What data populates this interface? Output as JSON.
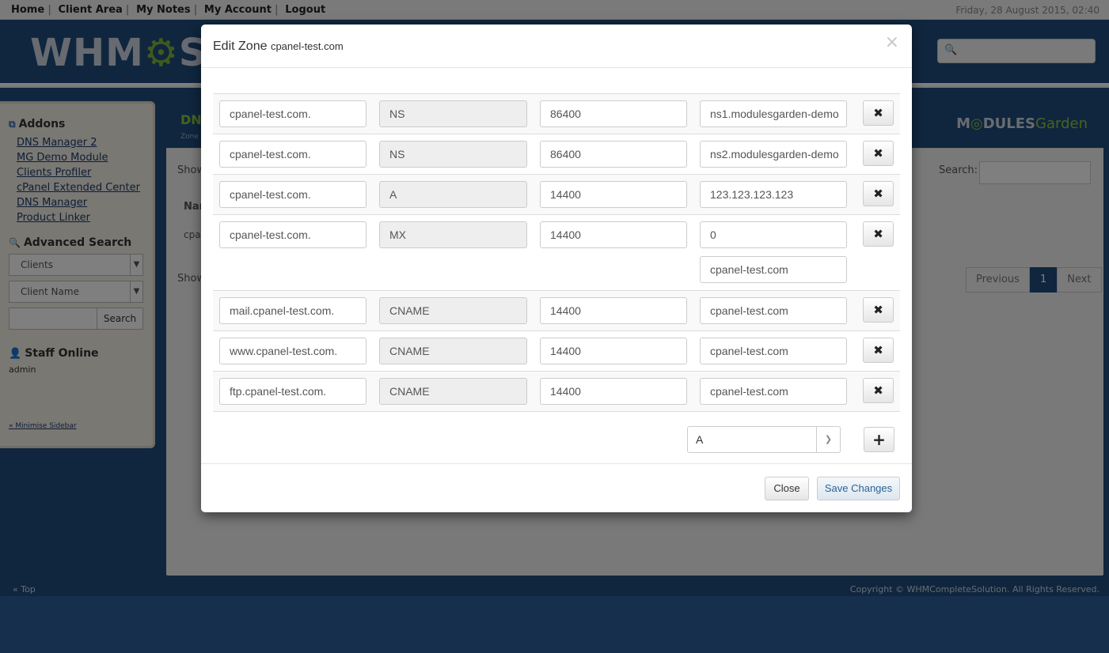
{
  "topnav": {
    "links": [
      "Home",
      "Client Area",
      "My Notes",
      "My Account",
      "Logout"
    ],
    "date": "Friday, 28 August 2015, 02:40"
  },
  "logo": {
    "text_a": "WHM",
    "text_b": "S"
  },
  "sidebar": {
    "addons_title": "Addons",
    "addons": [
      "DNS Manager 2",
      "MG Demo Module",
      "Clients Profiler",
      "cPanel Extended Center",
      "DNS Manager",
      "Product Linker"
    ],
    "adv_search_title": "Advanced Search",
    "select1": "Clients",
    "select2": "Client Name",
    "search_button": "Search",
    "staff_title": "Staff Online",
    "staff_name": "admin",
    "minimise": "« Minimise Sidebar"
  },
  "content": {
    "dn": "DN",
    "zones": "Zone",
    "show1": "Show",
    "nam": "Nar",
    "cpa": "cpa",
    "show2": "Show",
    "search_label": "Search:",
    "brand_a": "M",
    "brand_b": "DULES",
    "brand_c": "Garden",
    "pager": {
      "prev": "Previous",
      "page": "1",
      "next": "Next"
    }
  },
  "footer": {
    "top": "« Top",
    "copyright": "Copyright © WHMCompleteSolution. All Rights Reserved."
  },
  "modal": {
    "title": "Edit Zone",
    "subtitle": "cpanel-test.com",
    "close_symbol": "×",
    "records": [
      {
        "host": "cpanel-test.com.",
        "type": "NS",
        "ttl": "86400",
        "value": "ns1.modulesgarden-demo"
      },
      {
        "host": "cpanel-test.com.",
        "type": "NS",
        "ttl": "86400",
        "value": "ns2.modulesgarden-demo"
      },
      {
        "host": "cpanel-test.com.",
        "type": "A",
        "ttl": "14400",
        "value": "123.123.123.123"
      },
      {
        "host": "cpanel-test.com.",
        "type": "MX",
        "ttl": "14400",
        "value": "0",
        "value2": "cpanel-test.com"
      },
      {
        "host": "mail.cpanel-test.com.",
        "type": "CNAME",
        "ttl": "14400",
        "value": "cpanel-test.com"
      },
      {
        "host": "www.cpanel-test.com.",
        "type": "CNAME",
        "ttl": "14400",
        "value": "cpanel-test.com"
      },
      {
        "host": "ftp.cpanel-test.com.",
        "type": "CNAME",
        "ttl": "14400",
        "value": "cpanel-test.com"
      }
    ],
    "new_record_type": "A",
    "delete_symbol": "✖",
    "add_symbol": "+",
    "close_button": "Close",
    "save_button": "Save Changes"
  }
}
